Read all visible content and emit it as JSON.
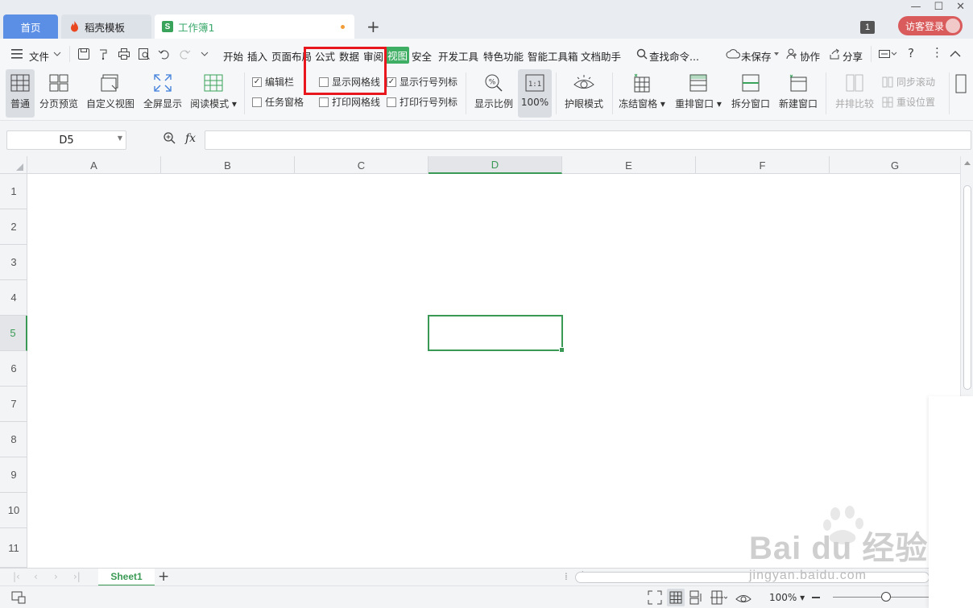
{
  "titlebar": {
    "tabs": [
      {
        "label": "首页"
      },
      {
        "label": "稻壳模板"
      },
      {
        "label": "工作簿1"
      }
    ],
    "notification_count": "1",
    "login_label": "访客登录"
  },
  "menu": {
    "file": "文件",
    "items": [
      "开始",
      "插入",
      "页面布局",
      "公式",
      "数据",
      "审阅",
      "视图",
      "安全",
      "开发工具",
      "特色功能",
      "智能工具箱",
      "文档助手"
    ],
    "active": "视图",
    "search": "查找命令...",
    "unsaved": "未保存",
    "collab": "协作",
    "share": "分享"
  },
  "ribbon": {
    "normal": "普通",
    "page_break": "分页预览",
    "custom_view": "自定义视图",
    "fullscreen": "全屏显示",
    "reading_mode": "阅读模式",
    "cb_formula_bar": "编辑栏",
    "cb_task_pane": "任务窗格",
    "cb_show_grid": "显示网格线",
    "cb_print_grid": "打印网格线",
    "cb_show_headers": "显示行号列标",
    "cb_print_headers": "打印行号列标",
    "zoom_ratio": "显示比例",
    "zoom_100": "100%",
    "eye_mode": "护眼模式",
    "freeze": "冻结窗格",
    "rearrange": "重排窗口",
    "split": "拆分窗口",
    "new_window": "新建窗口",
    "side_by_side": "并排比较",
    "sync_scroll": "同步滚动",
    "reset_pos": "重设位置"
  },
  "formula": {
    "name_box": "D5",
    "fx": "fx",
    "value": ""
  },
  "grid": {
    "columns": [
      "A",
      "B",
      "C",
      "D",
      "E",
      "F",
      "G"
    ],
    "rows": [
      "1",
      "2",
      "3",
      "4",
      "5",
      "6",
      "7",
      "8",
      "9",
      "10",
      "11"
    ],
    "selected_col": "D",
    "selected_row": "5"
  },
  "sheets": {
    "tabs": [
      "Sheet1"
    ]
  },
  "status": {
    "zoom": "100%"
  },
  "watermark": {
    "logo": "Bai du 经验",
    "url": "jingyan.baidu.com"
  },
  "colors": {
    "accent": "#3eae64",
    "highlight": "#e8161d",
    "home_tab": "#5b8fe6"
  }
}
